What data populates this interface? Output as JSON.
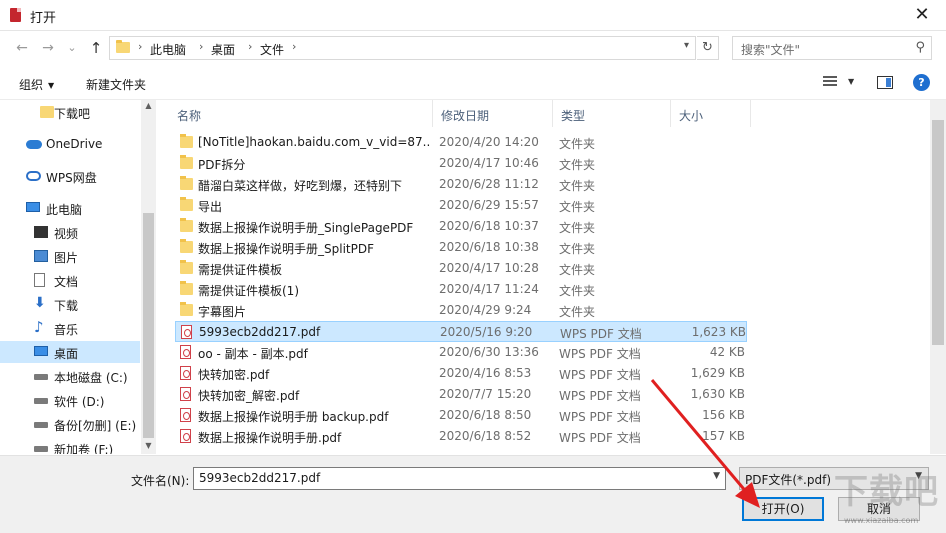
{
  "window": {
    "title": "打开",
    "close_glyph": "✕"
  },
  "nav": {
    "back_glyph": "←",
    "forward_glyph": "→",
    "recent_glyph": "⌄",
    "up_glyph": "↑",
    "breadcrumb": [
      "此电脑",
      "桌面",
      "文件"
    ],
    "sep_glyph": "›",
    "refresh_glyph": "↻",
    "search_placeholder": "搜索\"文件\""
  },
  "toolbar": {
    "organize_label": "组织",
    "new_folder_label": "新建文件夹",
    "help_glyph": "?"
  },
  "sidebar": {
    "items": [
      {
        "label": "下载吧",
        "icon": "folder-icon"
      },
      {
        "label": "OneDrive",
        "icon": "cloud-icon"
      },
      {
        "label": "WPS网盘",
        "icon": "wps-cloud-icon"
      },
      {
        "label": "此电脑",
        "icon": "computer-icon"
      },
      {
        "label": "视频",
        "icon": "video-icon"
      },
      {
        "label": "图片",
        "icon": "picture-icon"
      },
      {
        "label": "文档",
        "icon": "document-icon"
      },
      {
        "label": "下载",
        "icon": "download-icon"
      },
      {
        "label": "音乐",
        "icon": "music-icon"
      },
      {
        "label": "桌面",
        "icon": "desktop-icon",
        "selected": true
      },
      {
        "label": "本地磁盘 (C:)",
        "icon": "drive-icon"
      },
      {
        "label": "软件 (D:)",
        "icon": "drive-icon"
      },
      {
        "label": "备份[勿删] (E:)",
        "icon": "drive-icon"
      },
      {
        "label": "新加卷 (F:)",
        "icon": "drive-icon"
      }
    ]
  },
  "columns": {
    "name": "名称",
    "modified": "修改日期",
    "type": "类型",
    "size": "大小"
  },
  "files": [
    {
      "name": "[NoTitle]haokan.baidu.com_v_vid=87...",
      "modified": "2020/4/20 14:20",
      "type": "文件夹",
      "size": "",
      "kind": "folder"
    },
    {
      "name": "PDF拆分",
      "modified": "2020/4/17 10:46",
      "type": "文件夹",
      "size": "",
      "kind": "folder"
    },
    {
      "name": "醋溜白菜这样做，好吃到爆，还特别下",
      "modified": "2020/6/28 11:12",
      "type": "文件夹",
      "size": "",
      "kind": "folder"
    },
    {
      "name": "导出",
      "modified": "2020/6/29 15:57",
      "type": "文件夹",
      "size": "",
      "kind": "folder"
    },
    {
      "name": "数据上报操作说明手册_SinglePagePDF",
      "modified": "2020/6/18 10:37",
      "type": "文件夹",
      "size": "",
      "kind": "folder"
    },
    {
      "name": "数据上报操作说明手册_SplitPDF",
      "modified": "2020/6/18 10:38",
      "type": "文件夹",
      "size": "",
      "kind": "folder"
    },
    {
      "name": "需提供证件模板",
      "modified": "2020/4/17 10:28",
      "type": "文件夹",
      "size": "",
      "kind": "folder"
    },
    {
      "name": "需提供证件模板(1)",
      "modified": "2020/4/17 11:24",
      "type": "文件夹",
      "size": "",
      "kind": "folder"
    },
    {
      "name": "字幕图片",
      "modified": "2020/4/29 9:24",
      "type": "文件夹",
      "size": "",
      "kind": "folder"
    },
    {
      "name": "5993ecb2dd217.pdf",
      "modified": "2020/5/16 9:20",
      "type": "WPS PDF 文档",
      "size": "1,623 KB",
      "kind": "pdf",
      "selected": true
    },
    {
      "name": "oo - 副本 - 副本.pdf",
      "modified": "2020/6/30 13:36",
      "type": "WPS PDF 文档",
      "size": "42 KB",
      "kind": "pdf"
    },
    {
      "name": "快转加密.pdf",
      "modified": "2020/4/16 8:53",
      "type": "WPS PDF 文档",
      "size": "1,629 KB",
      "kind": "pdf"
    },
    {
      "name": "快转加密_解密.pdf",
      "modified": "2020/7/7 15:20",
      "type": "WPS PDF 文档",
      "size": "1,630 KB",
      "kind": "pdf"
    },
    {
      "name": "数据上报操作说明手册 backup.pdf",
      "modified": "2020/6/18 8:50",
      "type": "WPS PDF 文档",
      "size": "156 KB",
      "kind": "pdf"
    },
    {
      "name": "数据上报操作说明手册.pdf",
      "modified": "2020/6/18 8:52",
      "type": "WPS PDF 文档",
      "size": "157 KB",
      "kind": "pdf"
    }
  ],
  "footer": {
    "filename_label": "文件名(N):",
    "filename_value": "5993ecb2dd217.pdf",
    "filetype_value": "PDF文件(*.pdf)",
    "open_label": "打开(O)",
    "cancel_label": "取消"
  },
  "watermark": {
    "text": "下载吧",
    "url": "www.xiazaiba.com"
  },
  "colors": {
    "selection": "#cce8ff",
    "accent": "#0078d7",
    "arrow": "#e02020"
  }
}
